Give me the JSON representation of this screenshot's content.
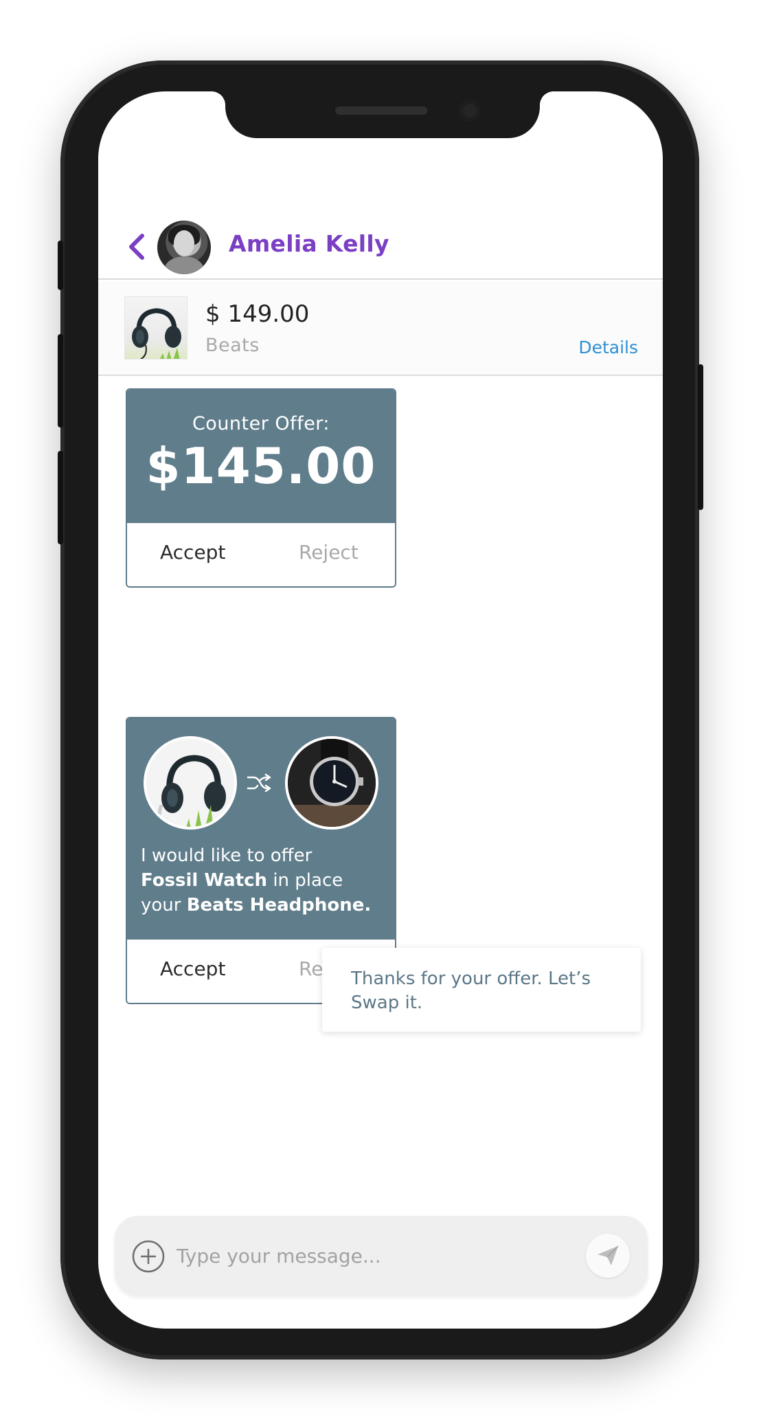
{
  "header": {
    "contact_name": "Amelia Kelly",
    "back_icon": "chevron-left-icon",
    "avatar": "avatar-photo"
  },
  "product": {
    "price": "$ 149.00",
    "brand": "Beats",
    "details_label": "Details",
    "thumb": "headphones-image"
  },
  "counter_offer": {
    "label": "Counter Offer:",
    "amount": "$145.00",
    "accept_label": "Accept",
    "reject_label": "Reject"
  },
  "swap_offer": {
    "left_image": "headphones-image",
    "swap_icon": "shuffle-icon",
    "right_image": "watch-image",
    "text_prefix": "I would like to offer",
    "offered_item": "Fossil Watch",
    "text_middle": "in place",
    "text_your": "your",
    "requested_item": "Beats Headphone.",
    "accept_label": "Accept",
    "reject_label": "Reject"
  },
  "reply": {
    "text": "Thanks for your offer. Let’s Swap it."
  },
  "composer": {
    "placeholder": "Type your message...",
    "add_icon": "plus-circle-icon",
    "send_icon": "send-icon"
  },
  "colors": {
    "accent": "#7b3fc4",
    "card": "#607d8b",
    "link": "#2e8fd3",
    "reply_text": "#5b7787"
  }
}
